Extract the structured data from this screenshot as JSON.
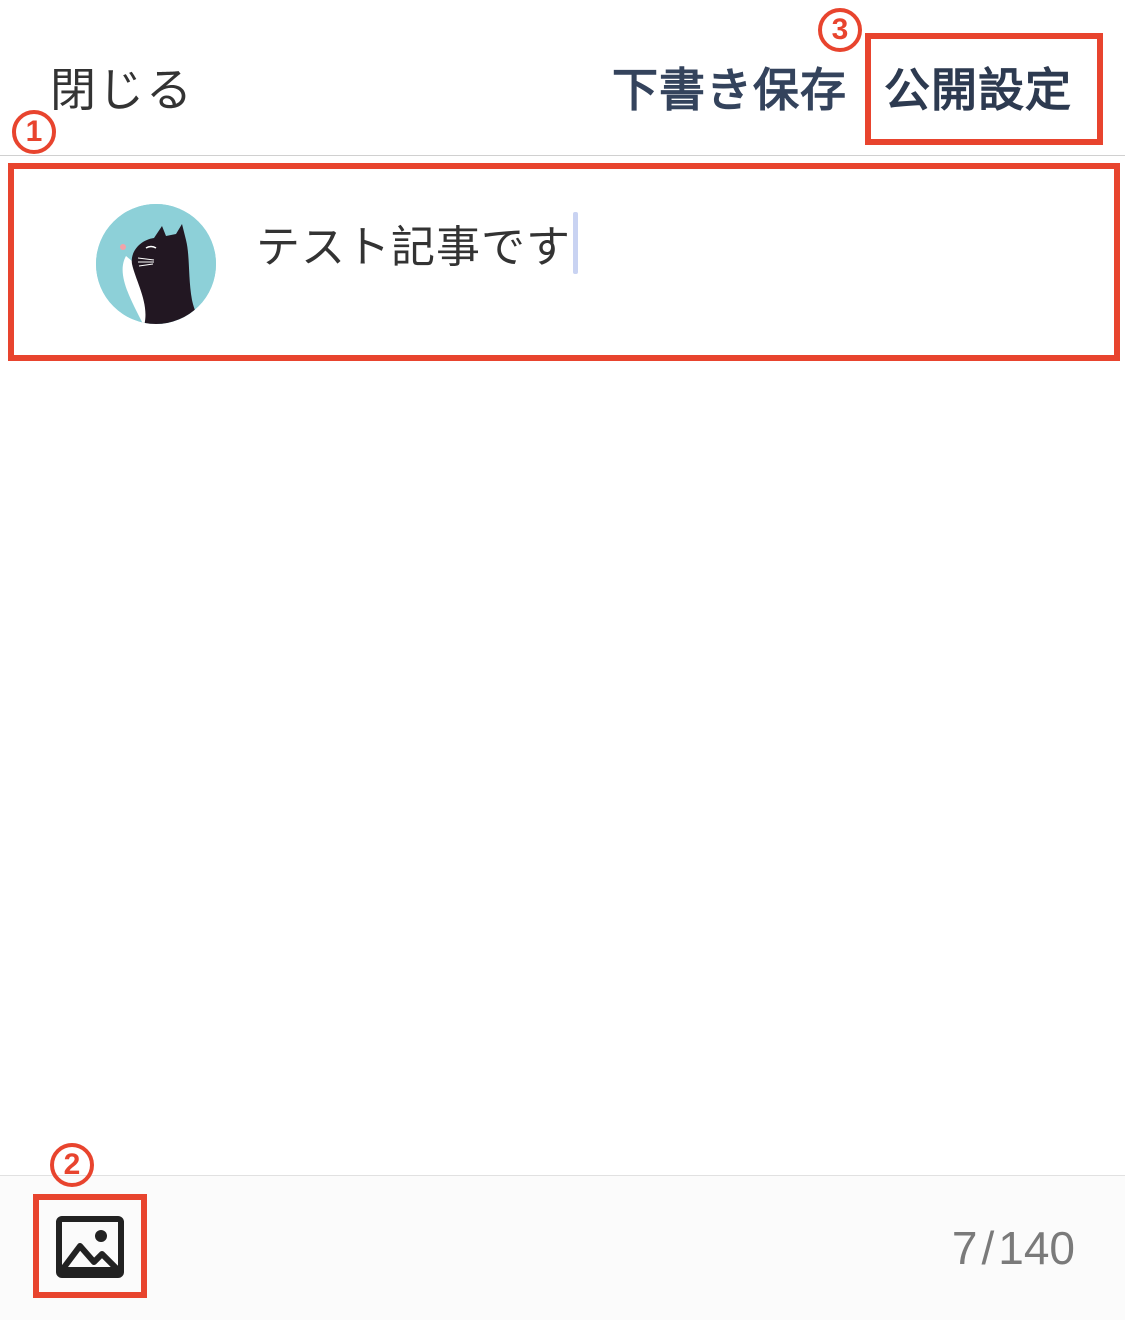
{
  "header": {
    "close_label": "閉じる",
    "draft_save_label": "下書き保存",
    "publish_settings_label": "公開設定"
  },
  "compose": {
    "avatar_icon": "black-cat-avatar-icon",
    "text": "テスト記事です"
  },
  "toolbar": {
    "image_icon": "image-icon",
    "char_count": "7",
    "char_limit": "140",
    "separator": "/"
  },
  "annotations": {
    "color": "#e8442e",
    "labels": [
      "1",
      "2",
      "3"
    ]
  },
  "colors": {
    "header_button": "#34435c",
    "counter_text": "#7a7a7a",
    "avatar_bg": "#8dd0d8",
    "caret": "#c9d3f2"
  }
}
